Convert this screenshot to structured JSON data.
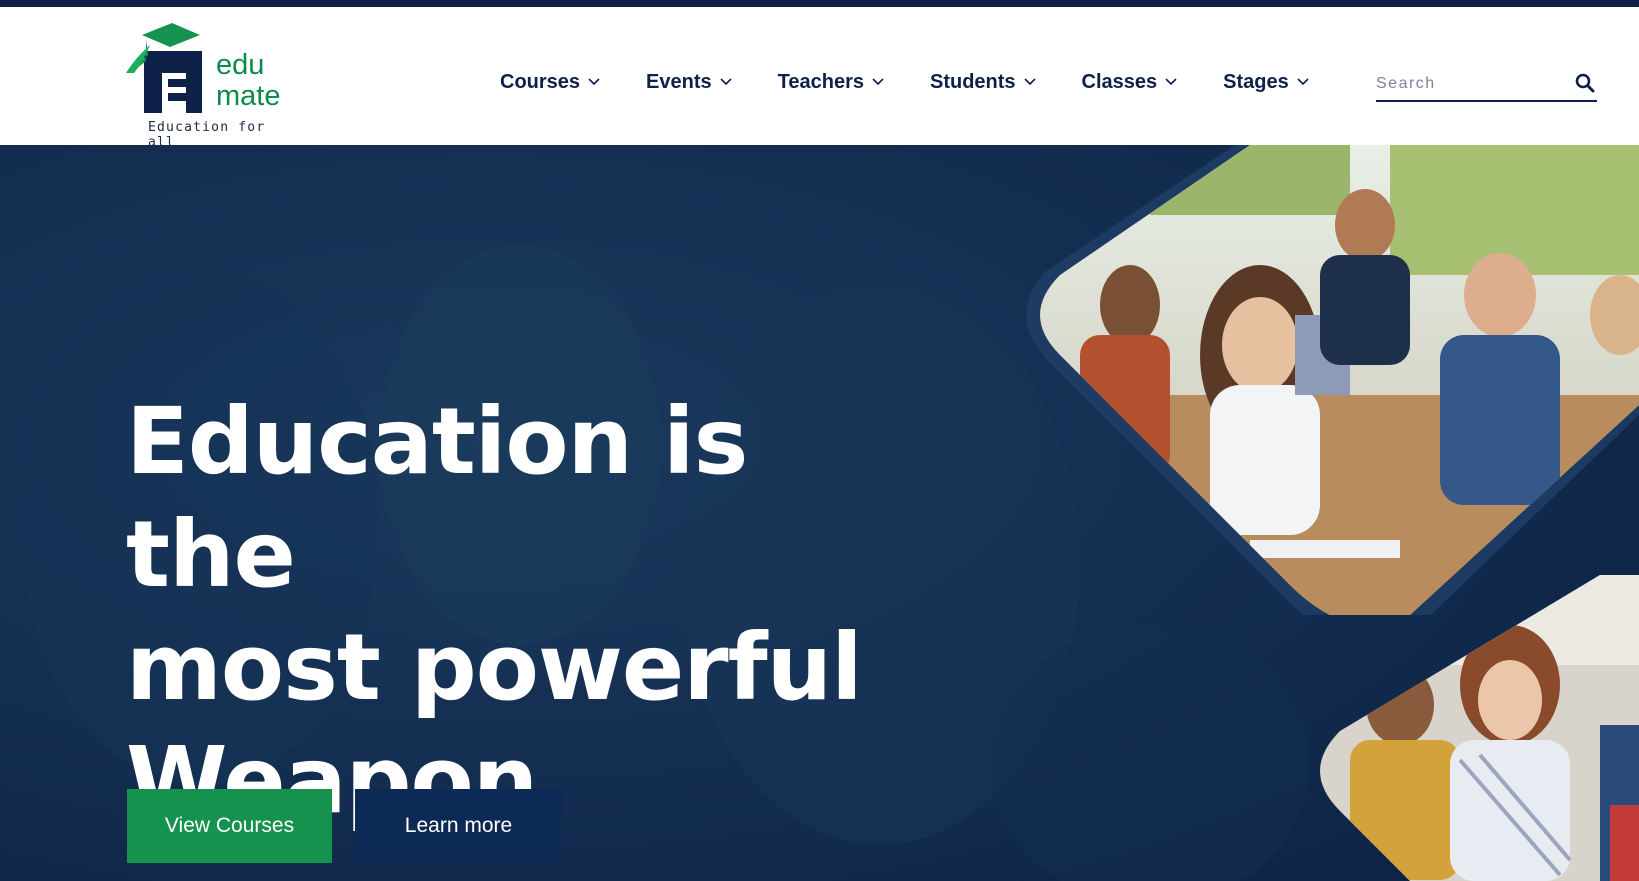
{
  "brand": {
    "name_line1": "edu",
    "name_line2": "mate",
    "tagline": "Education for all",
    "colors": {
      "primary": "#0d2149",
      "green": "#15924d",
      "hero_bg": "#102a4d"
    }
  },
  "nav": {
    "items": [
      {
        "label": "Courses",
        "icon": "chevron-down-icon"
      },
      {
        "label": "Events",
        "icon": "chevron-down-icon"
      },
      {
        "label": "Teachers",
        "icon": "chevron-down-icon"
      },
      {
        "label": "Students",
        "icon": "chevron-down-icon"
      },
      {
        "label": "Classes",
        "icon": "chevron-down-icon"
      },
      {
        "label": "Stages",
        "icon": "chevron-down-icon"
      }
    ]
  },
  "search": {
    "placeholder": "Search",
    "value": "",
    "icon": "search-icon"
  },
  "hero": {
    "headline_lines": [
      "Education is the",
      "most powerful",
      "Weapon"
    ],
    "primary_button": "View Courses",
    "secondary_button": "Learn more"
  }
}
